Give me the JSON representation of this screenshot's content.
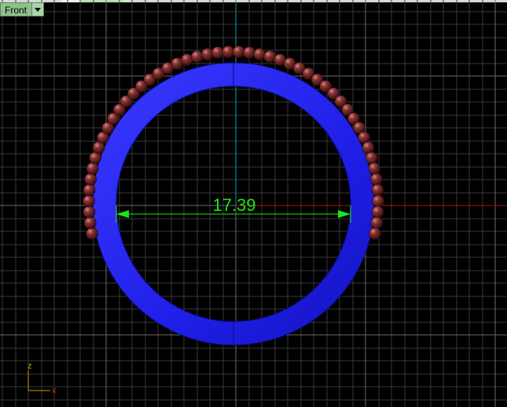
{
  "viewport": {
    "view_name": "Front",
    "dimension_value": "17.39",
    "axis_labels": {
      "vertical": "z",
      "horizontal": "x"
    }
  },
  "colors": {
    "background": "#000000",
    "grid_minor": "#3a3a3a",
    "grid_major": "#6a6a6a",
    "ring": "#2a2af0",
    "beads": "#7a2a2a",
    "dimension": "#19e619",
    "axis_x": "#b01010",
    "axis_z": "#0aa0a0",
    "tab": "#8fbf8f"
  },
  "icons": {
    "view_menu": "triangle-down-icon",
    "axis_gizmo": "world-axes-icon"
  }
}
